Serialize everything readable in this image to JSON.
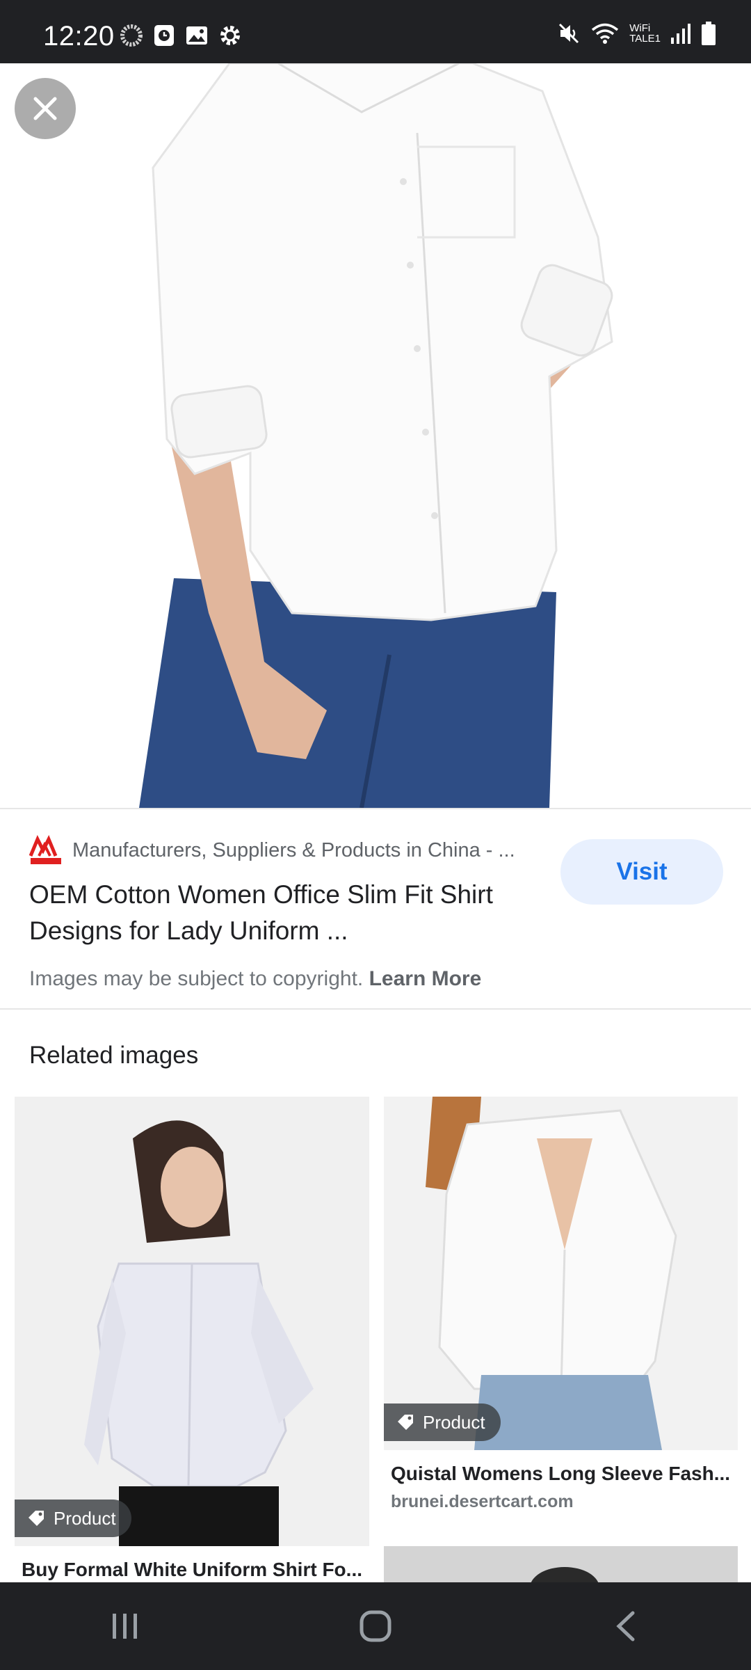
{
  "status_bar": {
    "time": "12:20",
    "wifi_label_top": "WiFi",
    "wifi_label_bottom": "TALE1"
  },
  "hero": {
    "close_label": "Close",
    "image_subject": "woman-white-shirt-jeans"
  },
  "source": {
    "site_name": "Manufacturers, Suppliers & Products in China - ...",
    "title": "OEM Cotton Women Office Slim Fit Shirt Designs for Lady Uniform ...",
    "visit_label": "Visit",
    "copyright_text": "Images may be subject to copyright.",
    "learn_more_label": "Learn More"
  },
  "related": {
    "heading": "Related images",
    "items": [
      {
        "badge": "Product",
        "title": "Buy Formal White Uniform Shirt Fo..."
      },
      {
        "badge": "Product",
        "title": "Quistal Womens Long Sleeve Fash...",
        "domain": "brunei.desertcart.com"
      }
    ]
  },
  "colors": {
    "status_bar_bg": "#202124",
    "visit_bg": "#e8f0fe",
    "visit_text": "#1a73e8",
    "badge_bg": "#3c4043"
  },
  "icons": {
    "status_left": [
      "sync-icon",
      "clock-icon",
      "gallery-icon",
      "settings-icon"
    ],
    "status_right": [
      "mute-icon",
      "wifi-icon",
      "signal-icon",
      "battery-icon"
    ],
    "nav": [
      "recents-icon",
      "home-icon",
      "back-icon"
    ]
  }
}
